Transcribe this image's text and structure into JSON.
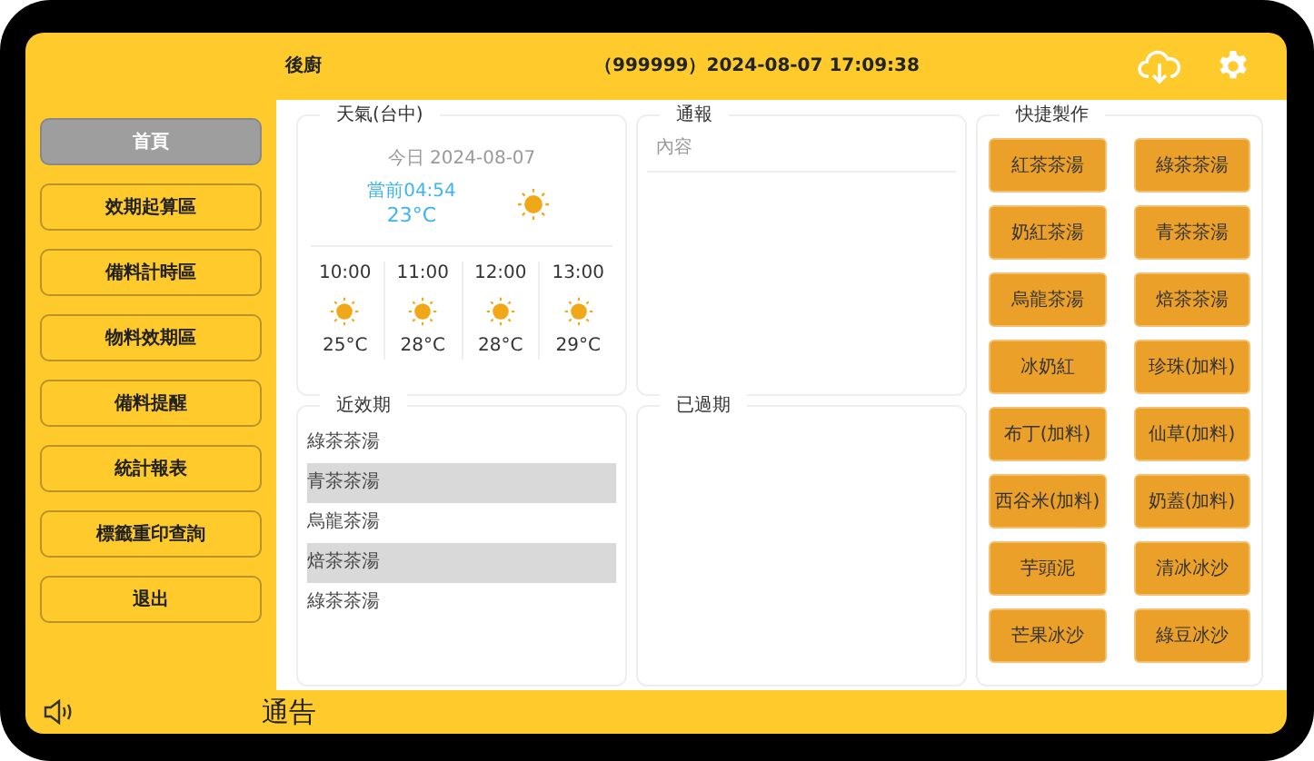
{
  "header": {
    "title": "後廚",
    "datetime": "（999999）2024-08-07 17:09:38"
  },
  "sidebar": {
    "items": [
      {
        "label": "首頁",
        "selected": true
      },
      {
        "label": "效期起算區",
        "selected": false
      },
      {
        "label": "備料計時區",
        "selected": false
      },
      {
        "label": "物料效期區",
        "selected": false
      },
      {
        "label": "備料提醒",
        "selected": false
      },
      {
        "label": "統計報表",
        "selected": false
      },
      {
        "label": "標籤重印查詢",
        "selected": false
      },
      {
        "label": "退出",
        "selected": false
      }
    ]
  },
  "weather": {
    "title": "天氣(台中)",
    "date_label": "今日",
    "date": "2024-08-07",
    "now_label": "當前04:54",
    "now_temp": "23°C",
    "hourly": [
      {
        "time": "10:00",
        "temp": "25°C"
      },
      {
        "time": "11:00",
        "temp": "28°C"
      },
      {
        "time": "12:00",
        "temp": "28°C"
      },
      {
        "time": "13:00",
        "temp": "29°C"
      }
    ]
  },
  "notice": {
    "title": "通報",
    "column": "內容"
  },
  "near_expiry": {
    "title": "近效期",
    "items": [
      "綠茶茶湯",
      "青茶茶湯",
      "烏龍茶湯",
      "焙茶茶湯",
      "綠茶茶湯"
    ]
  },
  "expired": {
    "title": "已過期"
  },
  "quick_make": {
    "title": "快捷製作",
    "buttons": [
      "紅茶茶湯",
      "綠茶茶湯",
      "奶紅茶湯",
      "青茶茶湯",
      "烏龍茶湯",
      "焙茶茶湯",
      "冰奶紅",
      "珍珠(加料)",
      "布丁(加料)",
      "仙草(加料)",
      "西谷米(加料)",
      "奶蓋(加料)",
      "芋頭泥",
      "清冰冰沙",
      "芒果冰沙",
      "綠豆冰沙"
    ]
  },
  "footer": {
    "label": "通告"
  }
}
